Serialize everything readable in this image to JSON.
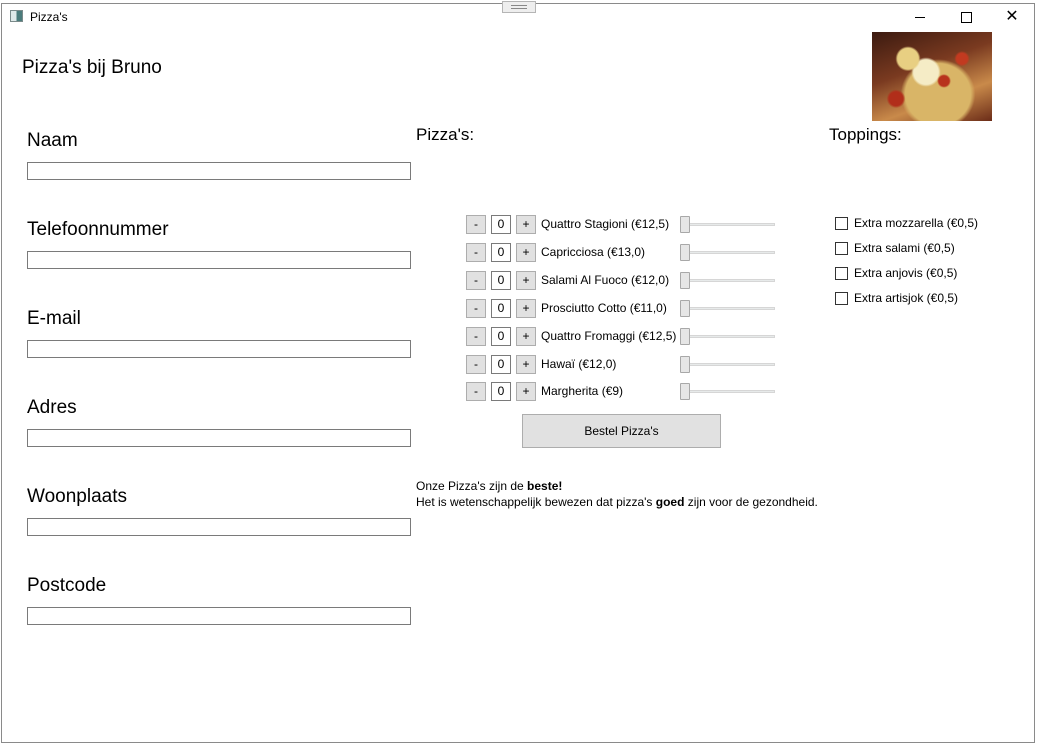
{
  "window": {
    "title": "Pizza's"
  },
  "header": {
    "title": "Pizza's bij Bruno"
  },
  "form": {
    "fields": [
      {
        "label": "Naam",
        "value": ""
      },
      {
        "label": "Telefoonnummer",
        "value": ""
      },
      {
        "label": "E-mail",
        "value": ""
      },
      {
        "label": "Adres",
        "value": ""
      },
      {
        "label": "Woonplaats",
        "value": ""
      },
      {
        "label": "Postcode",
        "value": ""
      }
    ]
  },
  "pizzas": {
    "heading": "Pizza's:",
    "minus_label": "-",
    "plus_label": "+",
    "items": [
      {
        "name": "Quattro Stagioni (€12,5)",
        "quantity": "0",
        "slider": 0
      },
      {
        "name": "Capricciosa (€13,0)",
        "quantity": "0",
        "slider": 0
      },
      {
        "name": "Salami Al Fuoco (€12,0)",
        "quantity": "0",
        "slider": 0
      },
      {
        "name": "Prosciutto Cotto (€11,0)",
        "quantity": "0",
        "slider": 0
      },
      {
        "name": "Quattro Fromaggi (€12,5)",
        "quantity": "0",
        "slider": 0
      },
      {
        "name": "Hawaï (€12,0)",
        "quantity": "0",
        "slider": 0
      },
      {
        "name": "Margherita (€9)",
        "quantity": "0",
        "slider": 0
      }
    ],
    "order_button": "Bestel Pizza's"
  },
  "toppings": {
    "heading": "Toppings:",
    "items": [
      {
        "label": "Extra mozzarella (€0,5)",
        "checked": false
      },
      {
        "label": "Extra salami (€0,5)",
        "checked": false
      },
      {
        "label": "Extra anjovis (€0,5)",
        "checked": false
      },
      {
        "label": "Extra artisjok (€0,5)",
        "checked": false
      }
    ]
  },
  "info": {
    "line1_prefix": "Onze Pizza's zijn de ",
    "line1_bold": "beste!",
    "line2_prefix": "Het is wetenschappelijk bewezen dat pizza's ",
    "line2_bold": "goed",
    "line2_suffix": " zijn voor de gezondheid."
  }
}
